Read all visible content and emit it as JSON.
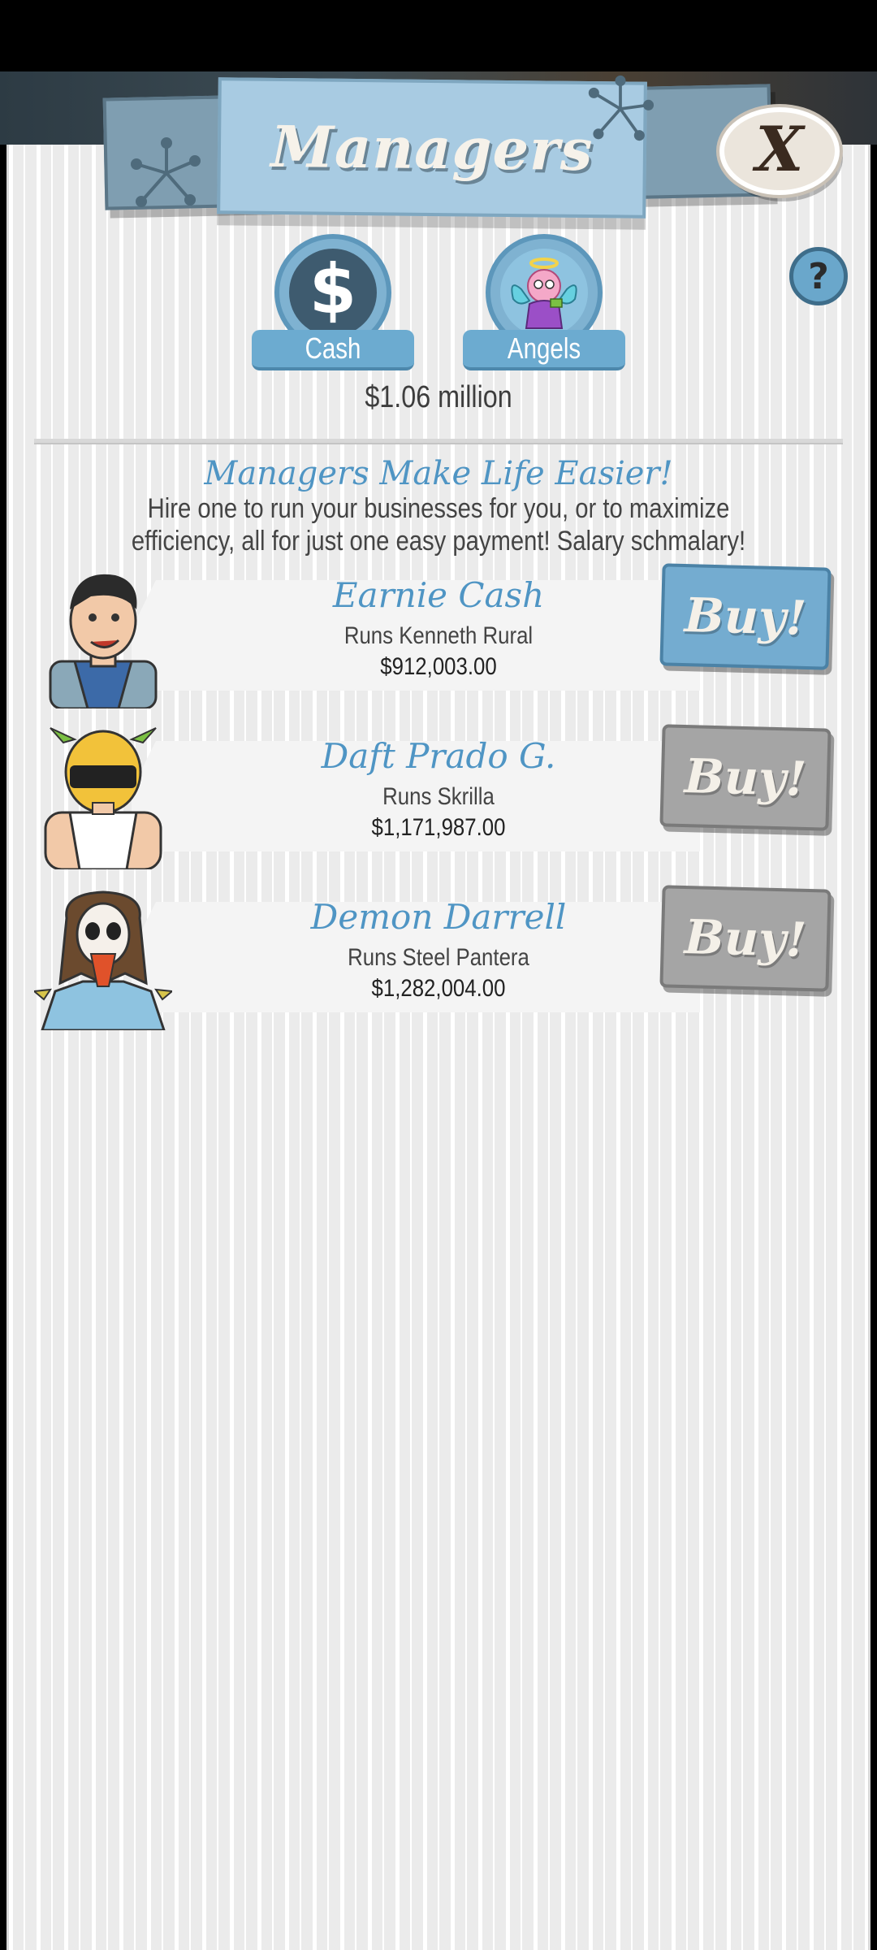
{
  "header": {
    "title": "Managers",
    "close_label": "X"
  },
  "tabs": [
    {
      "label": "Cash",
      "icon": "dollar-icon"
    },
    {
      "label": "Angels",
      "icon": "angel-icon"
    }
  ],
  "balance": "$1.06 million",
  "help_label": "?",
  "section": {
    "title": "Managers Make Life Easier!",
    "description": "Hire one to run your businesses for you, or to maximize efficiency, all for just one easy payment! Salary schmalary!"
  },
  "managers": [
    {
      "name": "Earnie Cash",
      "runs": "Runs Kenneth Rural",
      "cost": "$912,003.00",
      "buy_label": "Buy!",
      "affordable": true
    },
    {
      "name": "Daft Prado G.",
      "runs": "Runs Skrilla",
      "cost": "$1,171,987.00",
      "buy_label": "Buy!",
      "affordable": false
    },
    {
      "name": "Demon Darrell",
      "runs": "Runs Steel Pantera",
      "cost": "$1,282,004.00",
      "buy_label": "Buy!",
      "affordable": false
    }
  ],
  "colors": {
    "accent_blue": "#4f95c4",
    "buy_active": "#74acd0",
    "buy_disabled": "#a5a5a5",
    "panel_bg": "#ebebeb"
  }
}
